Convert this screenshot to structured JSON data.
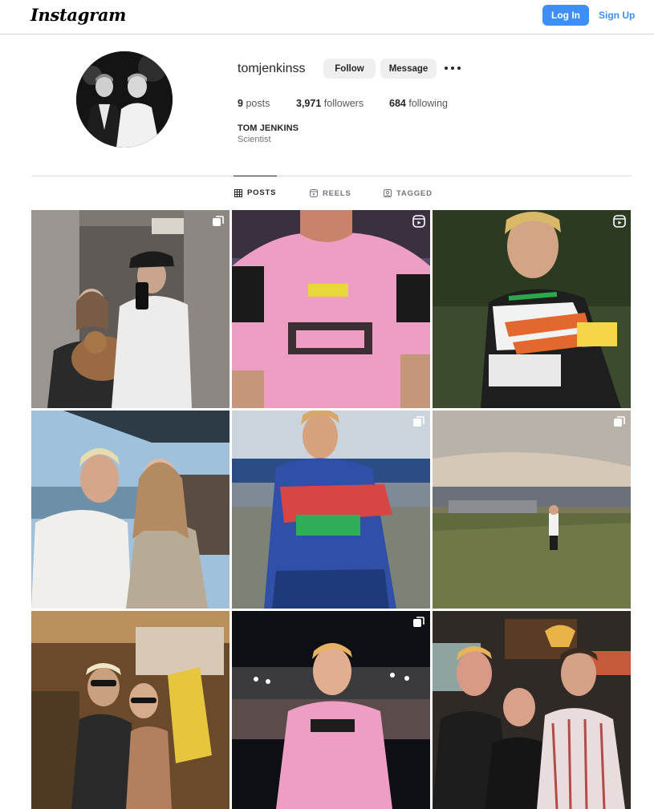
{
  "header": {
    "logo_text": "Instagram",
    "login_label": "Log In",
    "signup_label": "Sign Up",
    "accent_color": "#3e8ff5"
  },
  "profile": {
    "username": "tomjenkinss",
    "follow_label": "Follow",
    "message_label": "Message",
    "more_icon": "more-horizontal-icon",
    "posts_count": "9",
    "posts_label": "posts",
    "followers_count": "3,971",
    "followers_label": "followers",
    "following_count": "684",
    "following_label": "following",
    "full_name": "TOM JENKINS",
    "bio": "Scientist"
  },
  "tabs": [
    {
      "label": "POSTS",
      "icon": "grid-icon",
      "active": true
    },
    {
      "label": "REELS",
      "icon": "reels-icon",
      "active": false
    },
    {
      "label": "TAGGED",
      "icon": "tagged-icon",
      "active": false
    }
  ],
  "grid": [
    {
      "badge": "carousel-icon"
    },
    {
      "badge": "reel-icon"
    },
    {
      "badge": "reel-icon"
    },
    {
      "badge": "carousel-icon"
    },
    {
      "badge": "carousel-icon"
    },
    {
      "badge": "carousel-icon"
    },
    {
      "badge": "none"
    },
    {
      "badge": "carousel-icon"
    },
    {
      "badge": "none"
    }
  ],
  "colors": {
    "text_primary": "#262626",
    "text_secondary": "#737373",
    "button_gray": "#efefef",
    "border": "#dbdbdb"
  }
}
